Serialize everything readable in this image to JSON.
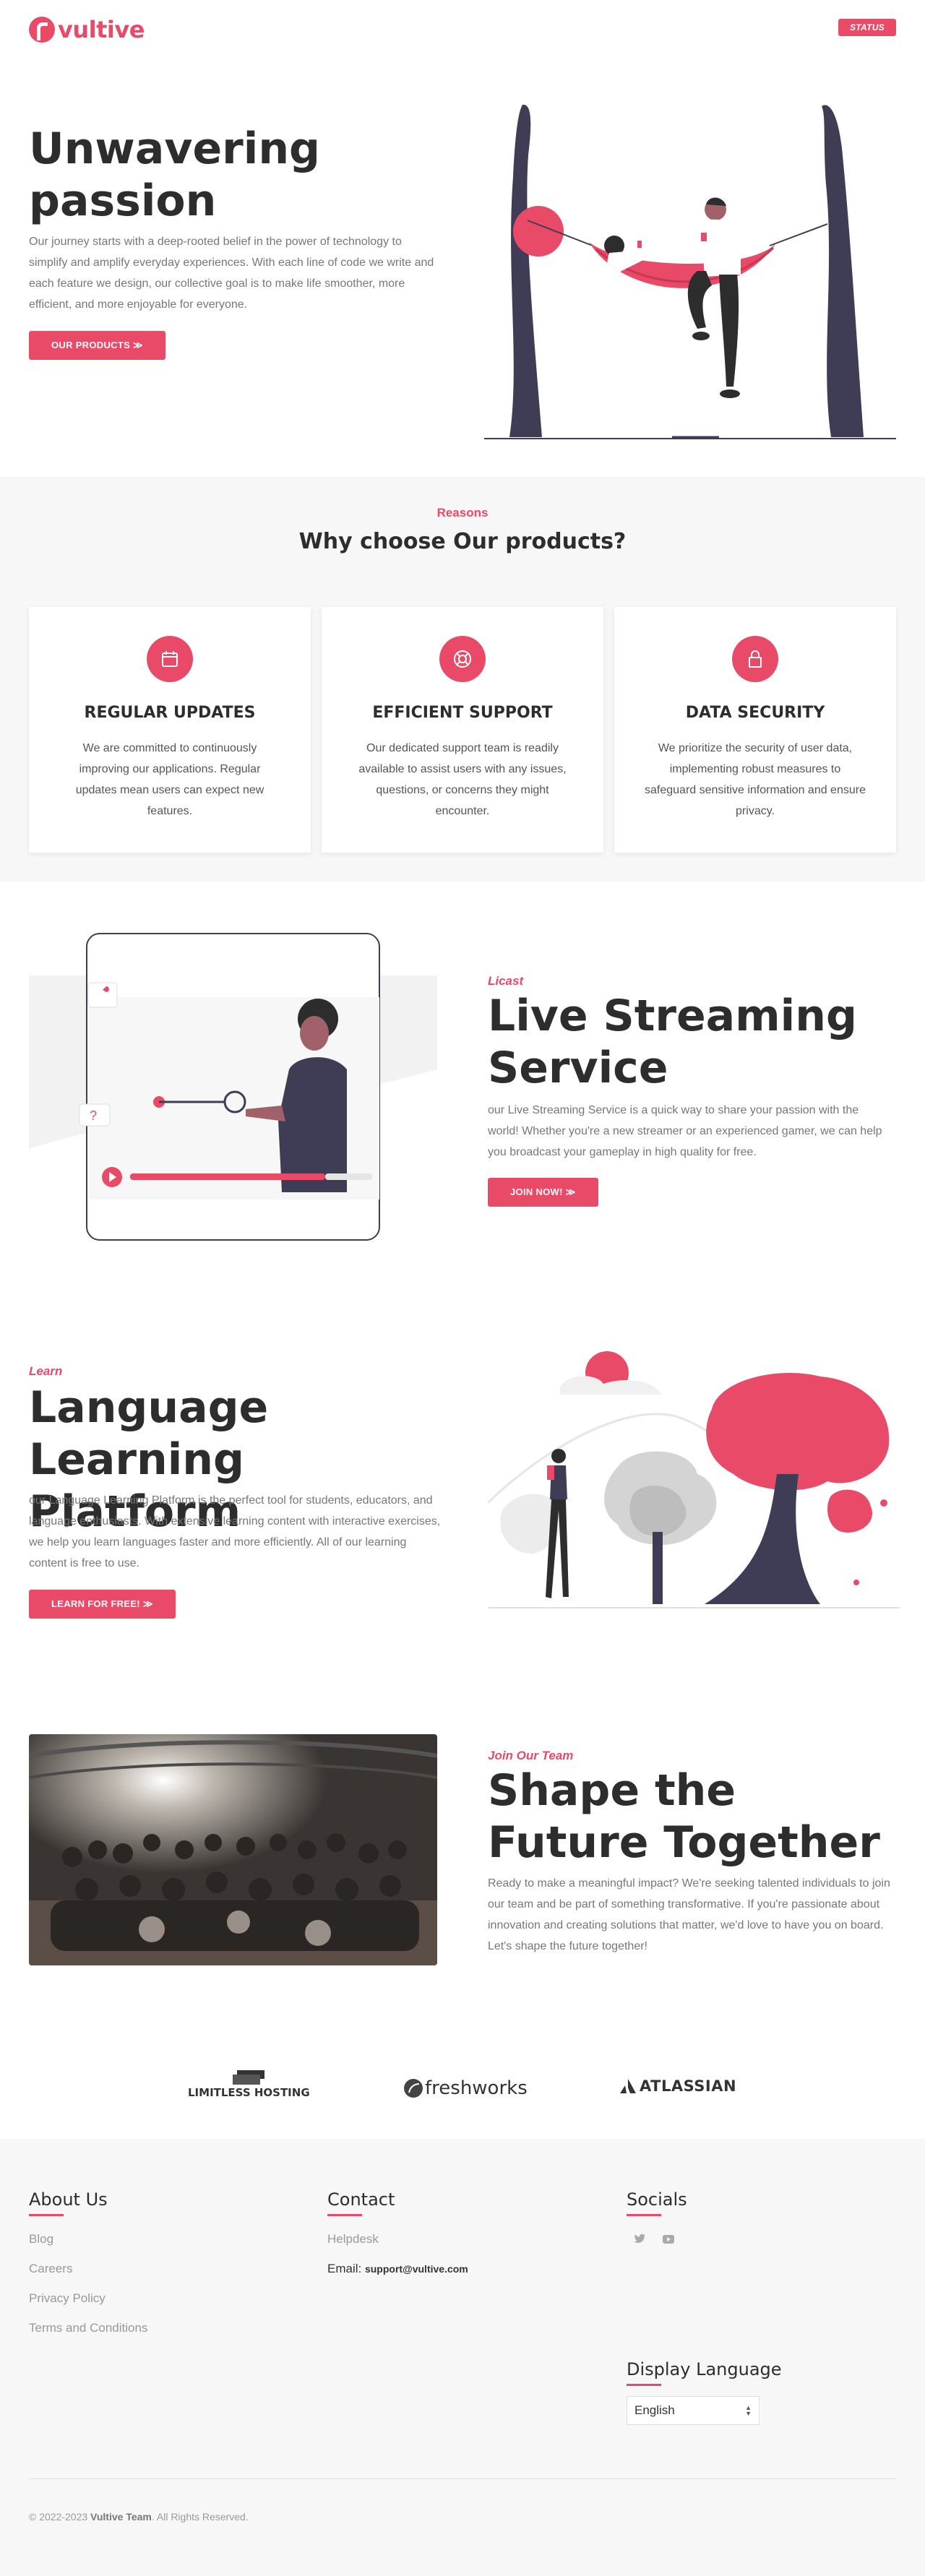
{
  "header": {
    "logo_text": "vultive",
    "status_label": "STATUS"
  },
  "hero": {
    "title": "Unwavering passion",
    "text": "Our journey starts with a deep-rooted belief in the power of technology to simplify and amplify everyday experiences. With each line of code we write and each feature we design, our collective goal is to make life smoother, more efficient, and more enjoyable for everyone.",
    "button": "OUR PRODUCTS ≫"
  },
  "reasons": {
    "kicker": "Reasons",
    "title": "Why choose Our products?",
    "cards": [
      {
        "icon": "calendar-icon",
        "title": "REGULAR UPDATES",
        "text": "We are committed to continuously improving our applications. Regular updates mean users can expect new features."
      },
      {
        "icon": "life-ring-icon",
        "title": "EFFICIENT SUPPORT",
        "text": "Our dedicated support team is readily available to assist users with any issues, questions, or concerns they might encounter."
      },
      {
        "icon": "lock-icon",
        "title": "DATA SECURITY",
        "text": "We prioritize the security of user data, implementing robust measures to safeguard sensitive information and ensure privacy."
      }
    ]
  },
  "streaming": {
    "kicker": "Licast",
    "title": "Live Streaming Service",
    "text": "our Live Streaming Service is a quick way to share your passion with the world! Whether you're a new streamer or an experienced gamer, we can help you broadcast your gameplay in high quality for free.",
    "button": "JOIN NOW! ≫"
  },
  "learning": {
    "kicker": "Learn",
    "title": "Language Learning Platform",
    "text": "our Language Learning Platform is the perfect tool for students, educators, and language enthusiasts. With extensive learning content with interactive exercises, we help you learn languages faster and more efficiently. All of our learning content is free to use.",
    "button": "LEARN FOR FREE! ≫"
  },
  "team": {
    "kicker": "Join Our Team",
    "title": "Shape the Future Together",
    "text": "Ready to make a meaningful impact? We're seeking talented individuals to join our team and be part of something transformative. If you're passionate about innovation and creating solutions that matter, we'd love to have you on board. Let's shape the future together!"
  },
  "partners": [
    "LIMITLESS HOSTING",
    "freshworks",
    "ATLASSIAN"
  ],
  "footer": {
    "about": {
      "title": "About Us",
      "links": [
        "Blog",
        "Careers",
        "Privacy Policy",
        "Terms and Conditions"
      ]
    },
    "contact": {
      "title": "Contact",
      "helpdesk": "Helpdesk",
      "email_label": "Email:",
      "email": "support@vultive.com"
    },
    "socials": {
      "title": "Socials",
      "icons": [
        "twitter-icon",
        "youtube-icon"
      ]
    },
    "language": {
      "title": "Display Language",
      "selected": "English"
    },
    "copyright_prefix": "© 2022-2023",
    "copyright_team": "Vultive Team",
    "copyright_suffix": ". All Rights Reserved."
  },
  "colors": {
    "accent": "#e84a68",
    "dark": "#3f3d56",
    "background_alt": "#f7f7f7"
  }
}
